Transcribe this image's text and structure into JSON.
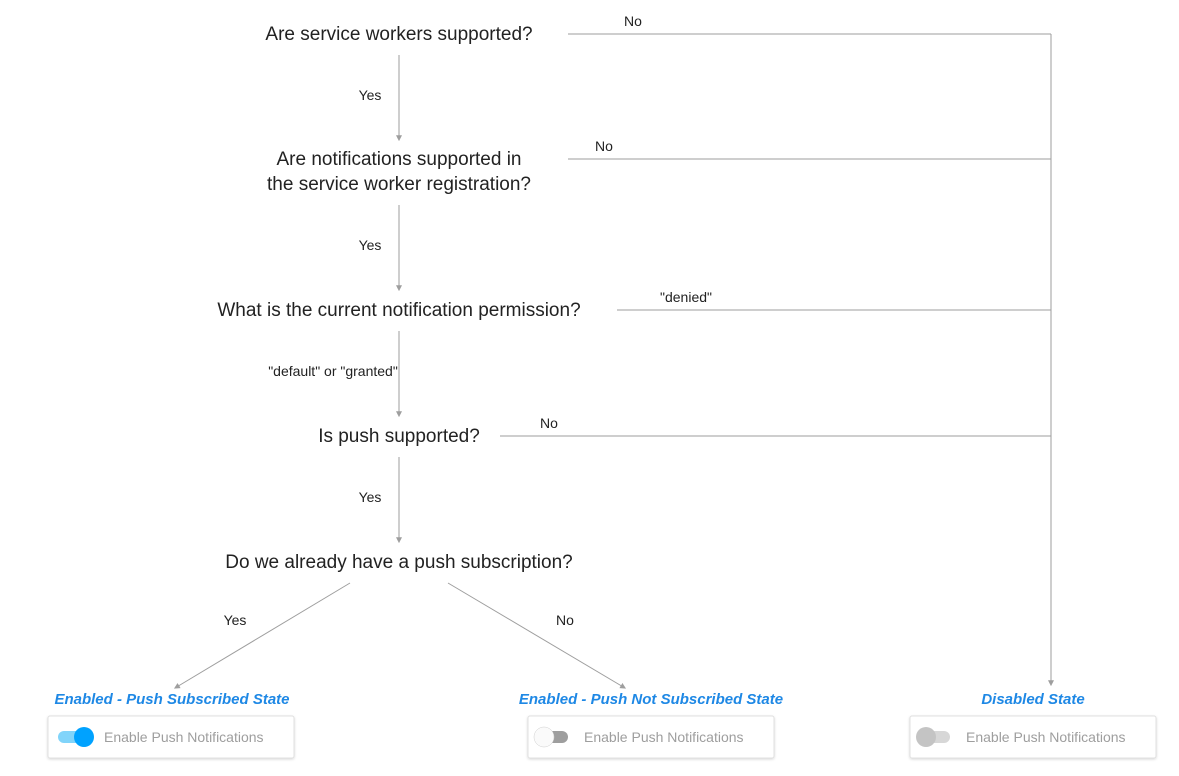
{
  "nodes": {
    "q1": "Are service workers supported?",
    "q2_l1": "Are notifications supported in",
    "q2_l2": "the service worker registration?",
    "q3": "What is the current notification permission?",
    "q4": "Is push supported?",
    "q5": "Do we already have a push subscription?"
  },
  "edges": {
    "q1_yes": "Yes",
    "q1_no": "No",
    "q2_yes": "Yes",
    "q2_no": "No",
    "q3_pass": "\"default\" or \"granted\"",
    "q3_no": "\"denied\"",
    "q4_yes": "Yes",
    "q4_no": "No",
    "q5_yes": "Yes",
    "q5_no": "No"
  },
  "states": {
    "subscribed": {
      "title": "Enabled - Push Subscribed State",
      "switch_label": "Enable Push Notifications"
    },
    "not_subscribed": {
      "title": "Enabled - Push Not Subscribed State",
      "switch_label": "Enable Push Notifications"
    },
    "disabled": {
      "title": "Disabled State",
      "switch_label": "Enable Push Notifications"
    }
  },
  "colors": {
    "accent": "#1e88e5",
    "muted": "#9e9e9e",
    "switch_on": "#00a2ff",
    "switch_off_track": "#9e9e9e",
    "switch_disabled_track": "#bdbdbd"
  }
}
